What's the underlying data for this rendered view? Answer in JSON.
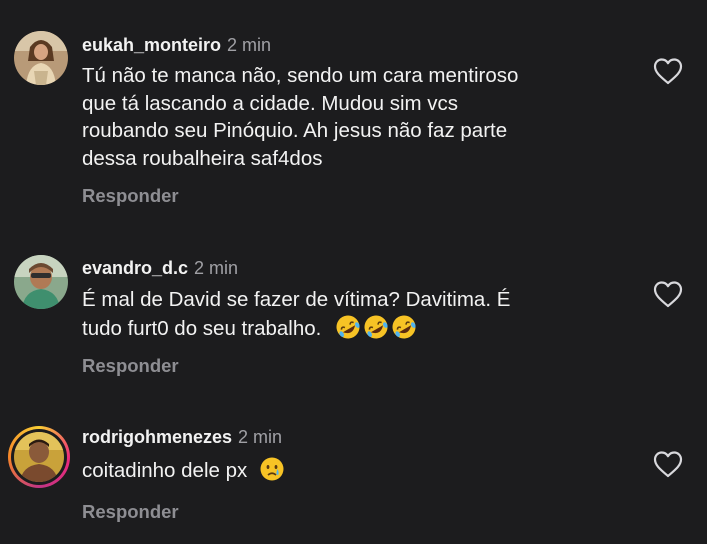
{
  "comments": [
    {
      "username": "eukah_monteiro",
      "time": "2 min",
      "lines": [
        "Tú não te manca não, sendo um cara mentiroso",
        "que tá lascando a cidade. Mudou sim vcs",
        "roubando seu Pinóquio. Ah jesus não faz parte",
        "dessa roubalheira saf4dos"
      ],
      "reply_label": "Responder",
      "avatar_icon": "profile-photo-woman",
      "like_icon": "heart-outline-icon"
    },
    {
      "username": "evandro_d.c",
      "time": "2 min",
      "lines": [
        "É mal de David se fazer de vítima? Davitima. É",
        "tudo furt0 do seu trabalho."
      ],
      "emojis": [
        "rolling-on-floor-laughing-emoji",
        "rolling-on-floor-laughing-emoji",
        "rolling-on-floor-laughing-emoji"
      ],
      "reply_label": "Responder",
      "avatar_icon": "profile-photo-man",
      "like_icon": "heart-outline-icon"
    },
    {
      "username": "rodrigohmenezes",
      "time": "2 min",
      "lines": [
        "coitadinho dele px"
      ],
      "emojis": [
        "crying-face-emoji"
      ],
      "reply_label": "Responder",
      "avatar_icon": "profile-photo-man-story-ring",
      "like_icon": "heart-outline-icon"
    }
  ],
  "colors": {
    "background": "#1c1c1e",
    "text": "#f2f2f2",
    "secondary": "#a0a0a5",
    "reply": "#8e8e93"
  }
}
